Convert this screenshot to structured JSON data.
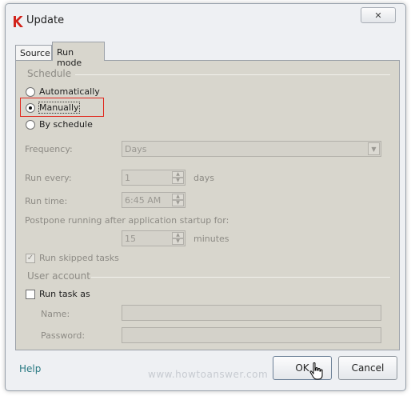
{
  "window": {
    "title": "Update",
    "close_label": "✕"
  },
  "tabs": [
    {
      "label": "Source",
      "active": false
    },
    {
      "label": "Run mode",
      "active": true
    }
  ],
  "schedule": {
    "section_label": "Schedule",
    "options": [
      {
        "label": "Automatically",
        "selected": false
      },
      {
        "label": "Manually",
        "selected": true
      },
      {
        "label": "By schedule",
        "selected": false
      }
    ],
    "frequency_label": "Frequency:",
    "frequency_value": "Days",
    "run_every_label": "Run every:",
    "run_every_value": "1",
    "run_every_unit": "days",
    "run_time_label": "Run time:",
    "run_time_value": "6:45 AM",
    "postpone_label": "Postpone running after application startup for:",
    "postpone_value": "15",
    "postpone_unit": "minutes",
    "run_skipped_label": "Run skipped tasks",
    "run_skipped_checked": true
  },
  "user_account": {
    "section_label": "User account",
    "run_task_as_label": "Run task as",
    "run_task_as_checked": false,
    "name_label": "Name:",
    "name_value": "",
    "password_label": "Password:",
    "password_value": ""
  },
  "footer": {
    "help_label": "Help",
    "watermark": "www.howtoanswer.com",
    "ok_label": "OK",
    "cancel_label": "Cancel"
  },
  "colors": {
    "panel_bg": "#d8d6cd",
    "highlight": "#e1261c",
    "help_link": "#2a7a83"
  }
}
